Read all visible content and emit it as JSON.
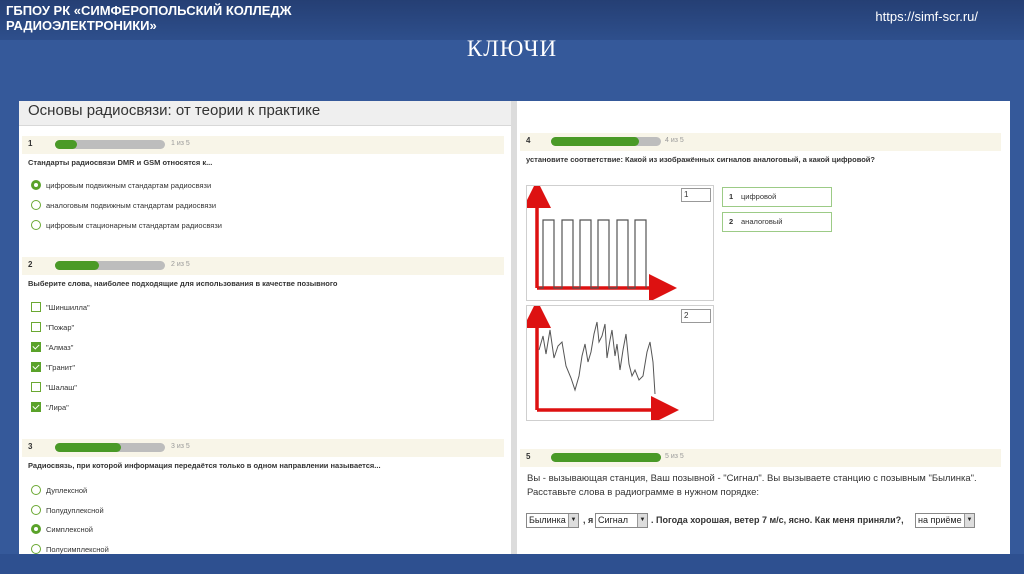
{
  "slide": {
    "org": "ГБПОУ РК «СИМФЕРОПОЛЬСКИЙ КОЛЛЕДЖ РАДИОЭЛЕКТРОНИКИ»",
    "url": "https://simf-scr.ru/",
    "title": "КЛЮЧИ"
  },
  "quiz": {
    "title": "Основы радиосвязи: от теории к практике",
    "q1": {
      "num": "1",
      "progress": 0.2,
      "count": "1 из 5",
      "text": "Стандарты радиосвязи DMR и GSM относятся к...",
      "options": [
        {
          "label": "цифровым подвижным стандартам радиосвязи",
          "checked": true
        },
        {
          "label": "аналоговым подвижным стандартам радиосвязи",
          "checked": false
        },
        {
          "label": "цифровым стационарным стандартам радиосвязи",
          "checked": false
        }
      ]
    },
    "q2": {
      "num": "2",
      "progress": 0.4,
      "count": "2 из 5",
      "text": "Выберите слова, наиболее подходящие для использования в качестве позывного",
      "options": [
        {
          "label": "\"Шиншилла\"",
          "checked": false
        },
        {
          "label": "\"Пожар\"",
          "checked": false
        },
        {
          "label": "\"Алмаз\"",
          "checked": true
        },
        {
          "label": "\"Гранит\"",
          "checked": true
        },
        {
          "label": "\"Шалаш\"",
          "checked": false
        },
        {
          "label": "\"Лира\"",
          "checked": true
        }
      ]
    },
    "q3": {
      "num": "3",
      "progress": 0.6,
      "count": "3 из 5",
      "text": "Радиосвязь, при которой информация передаётся только в одном направлении называется...",
      "options": [
        {
          "label": "Дуплексной",
          "checked": false
        },
        {
          "label": "Полудуплексной",
          "checked": false
        },
        {
          "label": "Симплексной",
          "checked": true
        },
        {
          "label": "Полусимплексной",
          "checked": false
        }
      ]
    },
    "q4": {
      "num": "4",
      "progress": 0.8,
      "count": "4 из 5",
      "text": "установите соответствие: Какой из изображённых сигналов аналоговый, а какой цифровой?",
      "inputs": [
        "1",
        "2"
      ],
      "answers": [
        {
          "n": "1",
          "label": "цифровой"
        },
        {
          "n": "2",
          "label": "аналоговый"
        }
      ]
    },
    "q5": {
      "num": "5",
      "progress": 1.0,
      "count": "5 из 5",
      "text": "Вы - вызывающая станция, Ваш позывной - \"Сигнал\". Вы вызываете станцию с позывным \"Былинка\". Расставьте слова в радиограмме в нужном порядке:",
      "select1": "Былинка",
      "sep1": ", я",
      "select2": "Сигнал",
      "sentence": ". Погода хорошая, ветер 7 м/с, ясно. Как меня приняли?,",
      "select3": "на приёме"
    }
  },
  "colors": {
    "slide_bg": "#35599a",
    "accent_green": "#4a9a27",
    "axis_red": "#dd1111"
  }
}
